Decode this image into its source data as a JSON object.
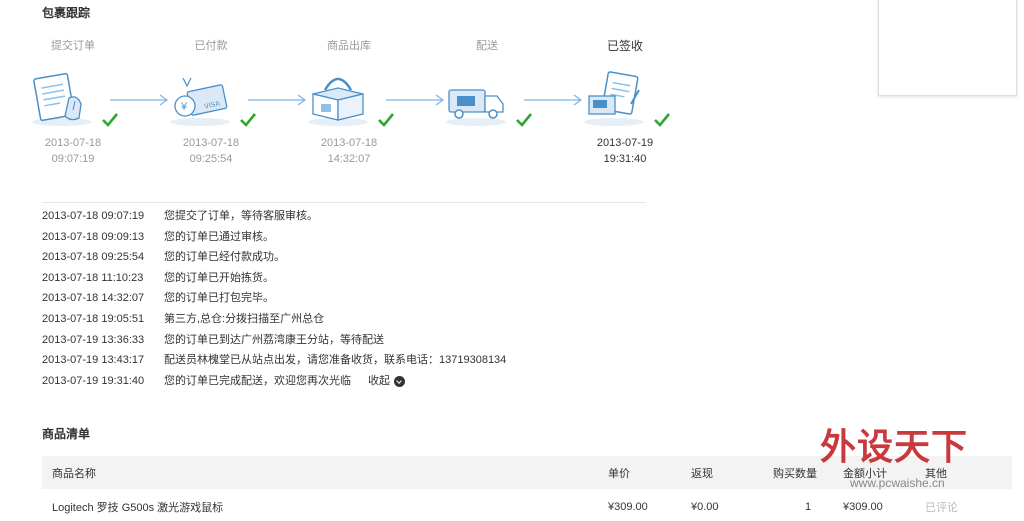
{
  "tracking": {
    "title": "包裹跟踪",
    "steps": [
      {
        "label": "提交订单",
        "date": "2013-07-18",
        "time": "09:07:19",
        "done": true
      },
      {
        "label": "已付款",
        "date": "2013-07-18",
        "time": "09:25:54",
        "done": true
      },
      {
        "label": "商品出库",
        "date": "2013-07-18",
        "time": "14:32:07",
        "done": true
      },
      {
        "label": "配送",
        "date": "",
        "time": "",
        "done": true
      },
      {
        "label": "已签收",
        "date": "2013-07-19",
        "time": "19:31:40",
        "done": true
      }
    ],
    "log": [
      {
        "time": "2013-07-18 09:07:19",
        "text": "您提交了订单，等待客服审核。"
      },
      {
        "time": "2013-07-18 09:09:13",
        "text": "您的订单已通过审核。"
      },
      {
        "time": "2013-07-18 09:25:54",
        "text": "您的订单已经付款成功。"
      },
      {
        "time": "2013-07-18 11:10:23",
        "text": "您的订单已开始拣货。"
      },
      {
        "time": "2013-07-18 14:32:07",
        "text": "您的订单已打包完毕。"
      },
      {
        "time": "2013-07-18 19:05:51",
        "text": "第三方,总仓:分拨扫描至广州总仓"
      },
      {
        "time": "2013-07-19 13:36:33",
        "text": "您的订单已到达广州荔湾康王分站，等待配送"
      },
      {
        "time": "2013-07-19 13:43:17",
        "text": "配送员林槐堂已从站点出发，请您准备收货，联系电话：13719308134"
      },
      {
        "time": "2013-07-19 19:31:40",
        "text": "您的订单已完成配送，欢迎您再次光临"
      }
    ],
    "collapse_label": "收起"
  },
  "products": {
    "title": "商品清单",
    "headers": {
      "name": "商品名称",
      "price": "单价",
      "rebate": "返现",
      "qty": "购买数量",
      "subtotal": "金额小计",
      "other": "其他"
    },
    "rows": [
      {
        "name": "Logitech 罗技 G500s 激光游戏鼠标",
        "price": "¥309.00",
        "rebate": "¥0.00",
        "qty": "1",
        "subtotal": "¥309.00",
        "other": "已评论"
      }
    ]
  },
  "watermark": {
    "cn": "外设天下",
    "url": "www.pcwaishe.cn"
  },
  "colors": {
    "check": "#2fa52f",
    "icon_blue": "#4a90c8",
    "arrow": "#7fb3e6"
  }
}
